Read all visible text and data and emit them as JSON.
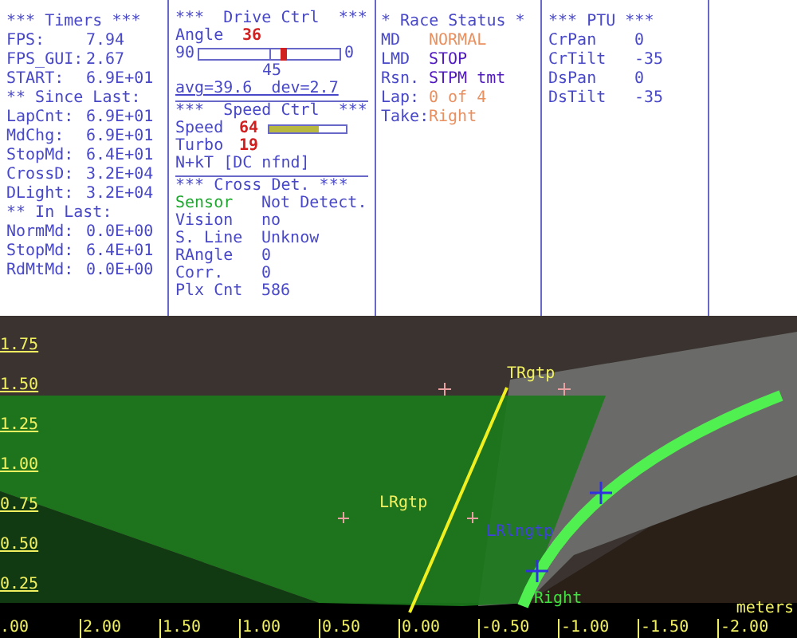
{
  "timers": {
    "title": "*** Timers ***",
    "rows": [
      {
        "label": "FPS:",
        "value": "7.94"
      },
      {
        "label": "FPS_GUI:",
        "value": "2.67"
      },
      {
        "label": "START:",
        "value": "6.9E+01"
      }
    ],
    "since_last": {
      "title": "** Since Last:",
      "rows": [
        {
          "label": "LapCnt:",
          "value": "6.9E+01"
        },
        {
          "label": "MdChg:",
          "value": "6.9E+01"
        },
        {
          "label": "StopMd:",
          "value": "6.4E+01"
        },
        {
          "label": "CrossD:",
          "value": "3.2E+04"
        },
        {
          "label": "DLight:",
          "value": "3.2E+04"
        }
      ]
    },
    "in_last": {
      "title": "** In Last:",
      "rows": [
        {
          "label": "NormMd:",
          "value": "0.0E+00"
        },
        {
          "label": "StopMd:",
          "value": "6.4E+01"
        },
        {
          "label": "RdMtMd:",
          "value": "0.0E+00"
        }
      ]
    }
  },
  "drive_ctrl": {
    "title": "***  Drive Ctrl  ***",
    "angle_label": "Angle",
    "angle_value": "36",
    "slider": {
      "min_label": "90",
      "max_label": "0",
      "mid_label": "45",
      "level": 0.6
    },
    "stats": "avg=39.6  dev=2.7"
  },
  "speed_ctrl": {
    "title": "***  Speed Ctrl  ***",
    "speed_label": "Speed",
    "speed_value": "64",
    "level": 0.65,
    "turbo_label": "Turbo",
    "turbo_value": "19",
    "note": "N+kT [DC nfnd]"
  },
  "cross_det": {
    "title": "*** Cross Det. ***",
    "rows": [
      {
        "label": "Sensor",
        "value": "Not Detect.",
        "color": "#20a830"
      },
      {
        "label": "Vision",
        "value": "no",
        "color": "#4848c8"
      },
      {
        "label": "S. Line",
        "value": "Unknow",
        "color": "#4848c8"
      },
      {
        "label": "RAngle",
        "value": "0",
        "color": "#4848c8"
      },
      {
        "label": "Corr.",
        "value": "0",
        "color": "#4848c8"
      },
      {
        "label": "Plx Cnt",
        "value": "586",
        "color": "#4848c8"
      }
    ]
  },
  "race_status": {
    "title": "* Race Status *",
    "rows": [
      {
        "label": "MD",
        "value": "NORMAL",
        "color": "#e89060"
      },
      {
        "label": "LMD",
        "value": "STOP",
        "color": "#5018c0"
      },
      {
        "label": "Rsn.",
        "value": "STPM tmt",
        "color": "#5018c0"
      },
      {
        "label": "Lap:",
        "value": "0 of 4",
        "color": "#e89060"
      },
      {
        "label": "Take:",
        "value": "Right",
        "color": "#e89060"
      }
    ]
  },
  "ptu": {
    "title": "*** PTU ***",
    "rows": [
      {
        "label": "CrPan",
        "value": "0"
      },
      {
        "label": "CrTilt",
        "value": "-35"
      },
      {
        "label": "DsPan",
        "value": "0"
      },
      {
        "label": "DsTilt",
        "value": "-35"
      }
    ]
  },
  "camera_view": {
    "y_ticks": [
      "1.75",
      "1.50",
      "1.25",
      "1.00",
      "0.75",
      "0.50",
      "0.25"
    ],
    "x_ticks": [
      ".00",
      "2.00",
      "1.50",
      "1.00",
      "0.50",
      "0.00",
      "-0.50",
      "-1.00",
      "-1.50",
      "-2.00"
    ],
    "unit": "meters",
    "markers": [
      {
        "label": "TRgtp",
        "color": "#f0f060"
      },
      {
        "label": "LRgtp",
        "color": "#f0f060"
      },
      {
        "label": "LRlngtp",
        "color": "#4040e0"
      },
      {
        "label": "Right",
        "color": "#40e040"
      }
    ]
  }
}
